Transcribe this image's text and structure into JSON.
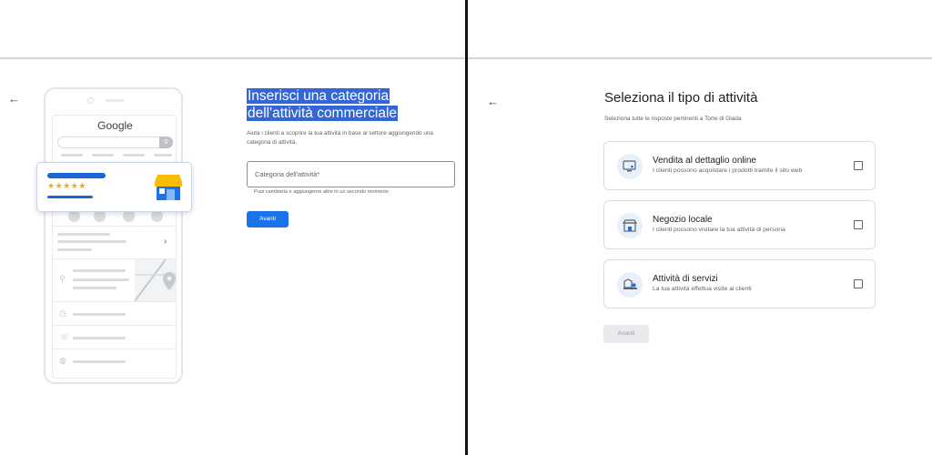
{
  "left": {
    "phone": {
      "brand": "Google",
      "stars": "★★★★★",
      "chevron": "›"
    },
    "title": "Inserisci una categoria dell'attività commerciale",
    "subtitle": "Aiuta i clienti a scoprire la tua attività in base al settore aggiungendo una categoria di attività.",
    "category_input": {
      "placeholder": "Categoria dell'attività*",
      "value": ""
    },
    "helper": "Puoi cambiarla e aggiungerne altre in un secondo momento",
    "next_label": "Avanti"
  },
  "right": {
    "title": "Seleziona il tipo di attività",
    "subtitle": "Seleziona tutte le risposte pertinenti a Torte di Giada",
    "options": [
      {
        "title": "Vendita al dettaglio online",
        "description": "I clienti possono acquistare i prodotti tramite il sito web",
        "icon": "online-store-icon",
        "checked": false
      },
      {
        "title": "Negozio locale",
        "description": "I clienti possono visitare la tua attività di persona",
        "icon": "storefront-icon",
        "checked": false
      },
      {
        "title": "Attività di servizi",
        "description": "La tua attività effettua visite ai clienti",
        "icon": "delivery-van-icon",
        "checked": false
      }
    ],
    "next_label": "Avanti"
  },
  "icons": {
    "back": "←",
    "search": "⚲",
    "pin": "⚲",
    "clock": "◷",
    "phone": "☏",
    "globe": "◍"
  },
  "colors": {
    "accent": "#1a73e8",
    "highlight": "#3367d6",
    "stars": "#f9ab00",
    "disabled_bg": "#e8eaed"
  }
}
